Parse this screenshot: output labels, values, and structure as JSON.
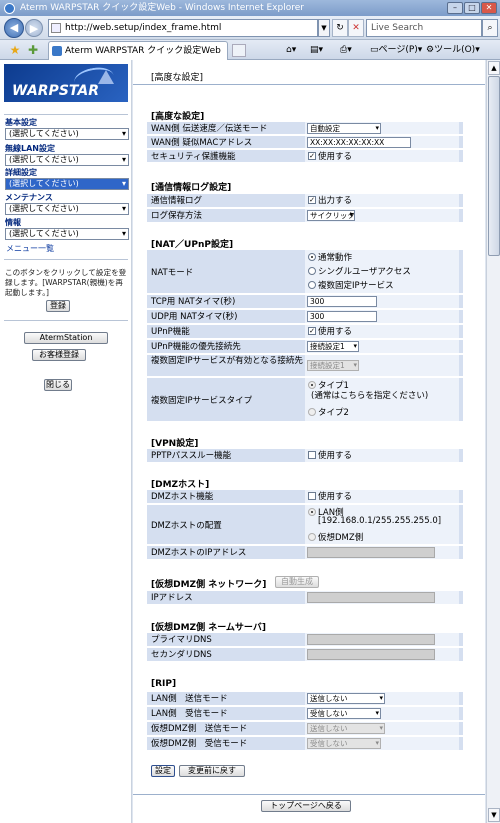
{
  "window": {
    "title": "Aterm WARPSTAR クイック設定Web - Windows Internet Explorer"
  },
  "browser": {
    "address": "http://web.setup/index_frame.html",
    "search_placeholder": "Live Search",
    "tab_title": "Aterm WARPSTAR クイック設定Web",
    "page_menu": "ページ(P)",
    "tools_menu": "ツール(O)"
  },
  "sidebar": {
    "logo": "WARPSTAR",
    "groups": [
      {
        "label": "基本設定",
        "selected": "(選択してください)"
      },
      {
        "label": "無線LAN設定",
        "selected": "(選択してください)"
      },
      {
        "label": "詳細設定",
        "selected": "(選択してください)"
      },
      {
        "label": "メンテナンス",
        "selected": "(選択してください)"
      },
      {
        "label": "情報",
        "selected": "(選択してください)"
      }
    ],
    "menu_list_link": "メニュー一覧",
    "note": "このボタンをクリックして設定を登録します。[WARPSTAR(親機)を再起動します。]",
    "register_button": "登録",
    "atermstation_button": "AtermStation",
    "customer_button": "お客様登録",
    "close_button": "閉じる"
  },
  "main": {
    "page_title": "[高度な設定]",
    "sections": {
      "advanced": {
        "title": "[高度な設定]",
        "wan_speed_label": "WAN側 伝送速度／伝送モード",
        "wan_speed_value": "自動設定",
        "wan_mac_label": "WAN側 疑似MACアドレス",
        "wan_mac_value": "XX:XX:XX:XX:XX:XX",
        "security_label": "セキュリティ保護機能",
        "security_value": "使用する"
      },
      "log": {
        "title": "[通信情報ログ設定]",
        "log_label": "通信情報ログ",
        "log_value": "出力する",
        "save_label": "ログ保存方法",
        "save_value": "サイクリック"
      },
      "nat": {
        "title": "[NAT／UPnP設定]",
        "mode_label": "NATモード",
        "mode_options": [
          "通常動作",
          "シングルユーザアクセス",
          "複数固定IPサービス"
        ],
        "tcp_label": "TCP用 NATタイマ(秒)",
        "tcp_value": "300",
        "udp_label": "UDP用 NATタイマ(秒)",
        "udp_value": "300",
        "upnp_label": "UPnP機能",
        "upnp_value": "使用する",
        "upnp_prio_label": "UPnP機能の優先接続先",
        "upnp_prio_value": "接続設定1",
        "multi_ip_label": "複数固定IPサービスが有効となる接続先",
        "multi_ip_value": "接続設定1",
        "multi_type_label": "複数固定IPサービスタイプ",
        "multi_type_opt1": "タイプ1",
        "multi_type_opt1_note": "(通常はこちらを指定ください)",
        "multi_type_opt2": "タイプ2"
      },
      "vpn": {
        "title": "[VPN設定]",
        "pptp_label": "PPTPパススルー機能",
        "pptp_value": "使用する"
      },
      "dmz": {
        "title": "[DMZホスト]",
        "func_label": "DMZホスト機能",
        "func_value": "使用する",
        "place_label": "DMZホストの配置",
        "place_lan": "LAN側",
        "place_lan_note": "[192.168.0.1/255.255.255.0]",
        "place_virtual": "仮想DMZ側",
        "ip_label": "DMZホストのIPアドレス"
      },
      "vdmz_net": {
        "title": "[仮想DMZ側 ネットワーク]",
        "auto_button": "自動生成",
        "ip_label": "IPアドレス"
      },
      "vdmz_dns": {
        "title": "[仮想DMZ側 ネームサーバ]",
        "primary_label": "プライマリDNS",
        "secondary_label": "セカンダリDNS"
      },
      "rip": {
        "title": "[RIP]",
        "lan_send_label": "LAN側　送信モード",
        "lan_send_value": "送信しない",
        "lan_recv_label": "LAN側　受信モード",
        "lan_recv_value": "受信しない",
        "vdmz_send_label": "仮想DMZ側　送信モード",
        "vdmz_send_value": "送信しない",
        "vdmz_recv_label": "仮想DMZ側　受信モード",
        "vdmz_recv_value": "受信しない"
      }
    },
    "set_button": "設定",
    "revert_button": "変更前に戻す",
    "top_button": "トップページへ戻る"
  },
  "colors": {
    "row_label_bg": "#d5dff0",
    "row_value_bg": "#edf2fa",
    "logo_bg": "#0d3b8e",
    "menu_label": "#03287e"
  }
}
